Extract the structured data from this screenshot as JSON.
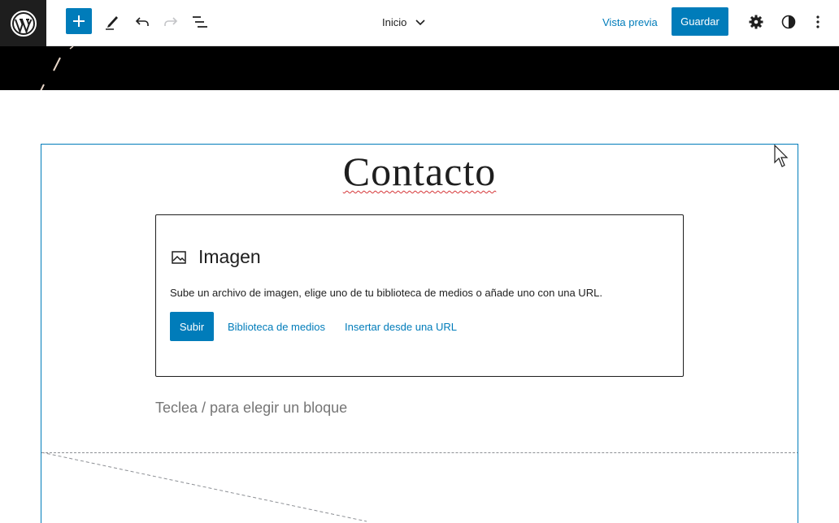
{
  "toolbar": {
    "document_title": "Inicio",
    "preview_label": "Vista previa",
    "save_label": "Guardar"
  },
  "editor": {
    "page_title": "Contacto",
    "image_block": {
      "title": "Imagen",
      "description": "Sube un archivo de imagen, elige uno de tu biblioteca de medios o añade uno con una URL.",
      "upload_label": "Subir",
      "media_library_label": "Biblioteca de medios",
      "insert_url_label": "Insertar desde una URL"
    },
    "appender_placeholder": "Teclea / para elegir un bloque"
  },
  "icons": [
    "wordpress-logo-icon",
    "plus-icon",
    "pencil-icon",
    "undo-icon",
    "redo-icon",
    "list-view-icon",
    "chevron-down-icon",
    "gear-icon",
    "contrast-icon",
    "more-vertical-icon",
    "image-icon",
    "mouse-cursor-icon"
  ],
  "colors": {
    "accent": "#007cba",
    "header_dark": "#1e1e1e",
    "strip": "#000000"
  }
}
